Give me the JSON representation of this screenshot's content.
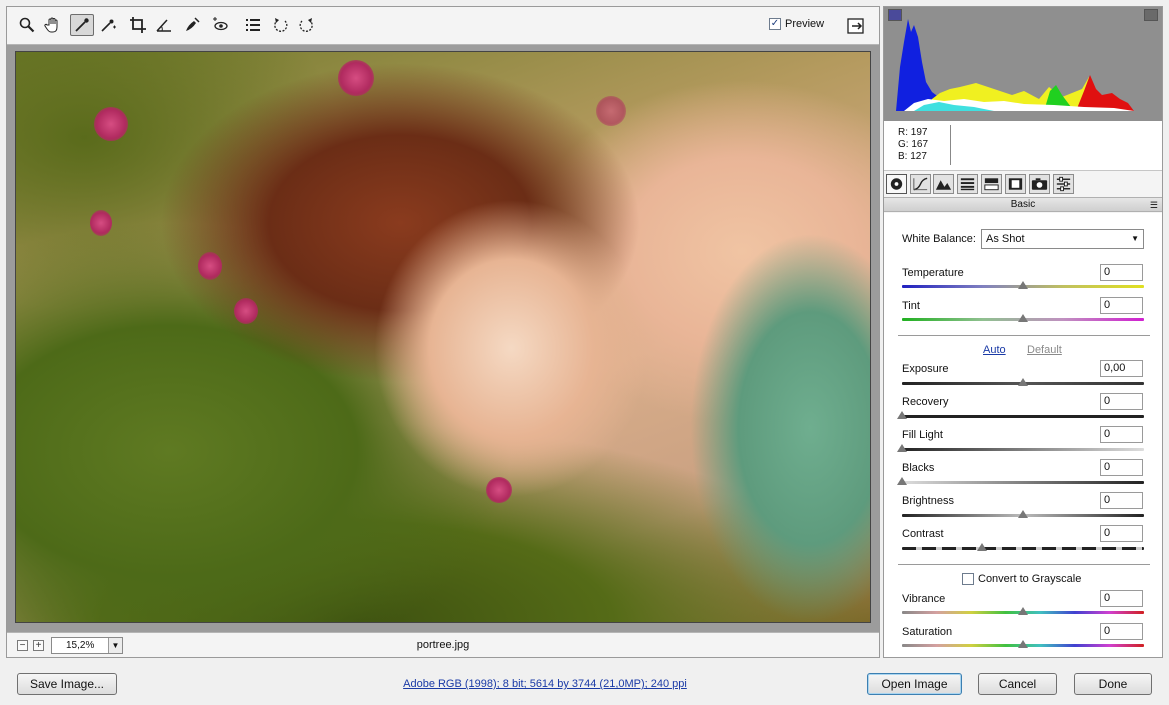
{
  "toolbar": {
    "tools": [
      {
        "name": "zoom-tool-icon"
      },
      {
        "name": "hand-tool-icon"
      },
      {
        "name": "white-balance-tool-icon"
      },
      {
        "name": "color-sampler-tool-icon"
      },
      {
        "name": "crop-tool-icon"
      },
      {
        "name": "straighten-tool-icon"
      },
      {
        "name": "retouch-tool-icon"
      },
      {
        "name": "red-eye-tool-icon"
      },
      {
        "name": "preferences-icon"
      },
      {
        "name": "rotate-left-icon"
      },
      {
        "name": "rotate-right-icon"
      }
    ],
    "preview_label": "Preview",
    "preview_checked": true
  },
  "image": {
    "zoom": "15,2%",
    "filename": "portree.jpg"
  },
  "readout": {
    "r": "R:  197",
    "g": "G:  167",
    "b": "B:  127"
  },
  "panel": {
    "section_title": "Basic",
    "white_balance": {
      "label": "White Balance:",
      "value": "As Shot"
    },
    "temperature": {
      "label": "Temperature",
      "value": "0",
      "level": 0.5
    },
    "tint": {
      "label": "Tint",
      "value": "0",
      "level": 0.5
    },
    "auto_label": "Auto",
    "default_label": "Default",
    "exposure": {
      "label": "Exposure",
      "value": "0,00",
      "level": 0.5
    },
    "recovery": {
      "label": "Recovery",
      "value": "0",
      "level": 0
    },
    "fill_light": {
      "label": "Fill Light",
      "value": "0",
      "level": 0
    },
    "blacks": {
      "label": "Blacks",
      "value": "0",
      "level": 0
    },
    "brightness": {
      "label": "Brightness",
      "value": "0",
      "level": 0.5
    },
    "contrast": {
      "label": "Contrast",
      "value": "0",
      "level": 0.33
    },
    "grayscale_label": "Convert to Grayscale",
    "vibrance": {
      "label": "Vibrance",
      "value": "0",
      "level": 0.5
    },
    "saturation": {
      "label": "Saturation",
      "value": "0",
      "level": 0.5
    }
  },
  "footer": {
    "save_label": "Save Image...",
    "info": "Adobe RGB (1998); 8 bit; 5614 by 3744 (21,0MP); 240 ppi",
    "open_label": "Open Image",
    "cancel_label": "Cancel",
    "done_label": "Done"
  },
  "colors": {
    "accent": "#3c7fb1",
    "histogram_bg": "#8f8f8f"
  }
}
